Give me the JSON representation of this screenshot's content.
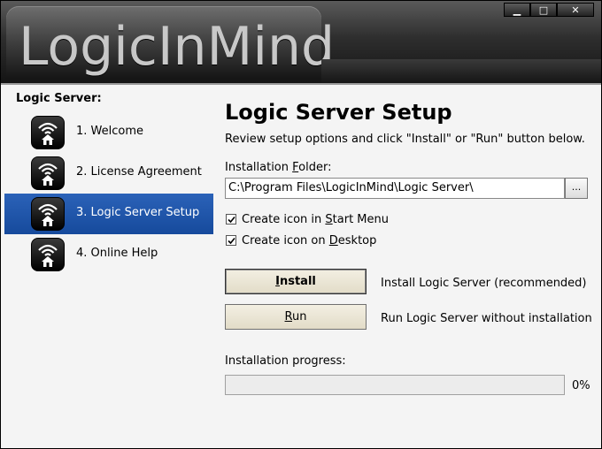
{
  "window": {
    "logo_text": "LogicInMind",
    "controls": {
      "minimize": "▁",
      "maximize": "□",
      "close": "✕"
    }
  },
  "sidebar": {
    "title": "Logic Server:",
    "items": [
      {
        "label": "1. Welcome",
        "icon": "wifi-home-icon",
        "active": false
      },
      {
        "label": "2. License Agreement",
        "icon": "wifi-home-icon",
        "active": false
      },
      {
        "label": "3. Logic Server Setup",
        "icon": "wifi-home-icon",
        "active": true
      },
      {
        "label": "4. Online Help",
        "icon": "wifi-home-icon",
        "active": false
      }
    ]
  },
  "main": {
    "title": "Logic Server Setup",
    "subtitle": "Review setup options and click \"Install\" or \"Run\" button below.",
    "folder_label_pre": "Installation ",
    "folder_label_ul": "F",
    "folder_label_post": "older:",
    "folder_value": "C:\\Program Files\\LogicInMind\\Logic Server\\",
    "browse_label": "...",
    "options": [
      {
        "pre": "Create icon in ",
        "ul": "S",
        "post": "tart Menu",
        "checked": true
      },
      {
        "pre": "Create icon on ",
        "ul": "D",
        "post": "esktop",
        "checked": true
      }
    ],
    "install": {
      "ul": "I",
      "rest": "nstall",
      "desc": "Install Logic Server (recommended)"
    },
    "run": {
      "ul": "R",
      "rest": "un",
      "desc": "Run Logic Server without installation"
    },
    "progress": {
      "label": "Installation progress:",
      "value": 0,
      "text": "0%"
    }
  },
  "colors": {
    "accent": "#1f57aa",
    "banner": "#2e2e2e"
  }
}
